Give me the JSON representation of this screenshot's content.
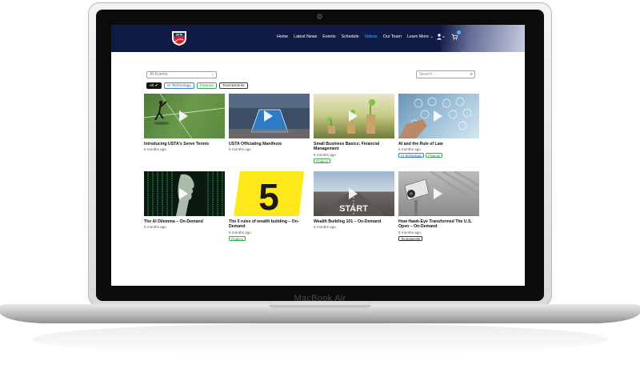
{
  "device": {
    "brand": "MacBook Air"
  },
  "nav": {
    "logo_text": "USTA",
    "items": [
      "Home",
      "Latest News",
      "Events",
      "Schedule",
      "Videos",
      "Our Team",
      "Learn More ⌄"
    ],
    "active_item": "Videos"
  },
  "filters": {
    "events_select": "All Events",
    "search_placeholder": "Search ...",
    "chips": [
      "All ✔",
      "AI Technology",
      "Finance",
      "Tournaments"
    ]
  },
  "videos": [
    {
      "title": "Introducing USTA's Serve Tennis",
      "date": "5 months ago",
      "tags": []
    },
    {
      "title": "USTA Officiating Manifesto",
      "date": "5 months ago",
      "tags": []
    },
    {
      "title": "Small Business Basics: Financial Management",
      "date": "6 months ago",
      "tags": [
        "Finance"
      ]
    },
    {
      "title": "AI and the Rule of Law",
      "date": "6 months ago",
      "tags": [
        "AI Technology",
        "Finance"
      ]
    },
    {
      "title": "The AI Dilemma – On-Demand",
      "date": "6 months ago",
      "tags": []
    },
    {
      "title": "The 5 rules of wealth building – On-Demand",
      "date": "6 months ago",
      "tags": [
        "Finance"
      ]
    },
    {
      "title": "Wealth Building 101 – On-Demand",
      "date": "6 months ago",
      "tags": []
    },
    {
      "title": "How Hawk-Eye Transformed The U.S. Open – On-Demand",
      "date": "6 months ago",
      "tags": [
        "Tournaments"
      ]
    }
  ],
  "thumb_text": {
    "five": "5",
    "start": "START"
  },
  "colors": {
    "nav_bg": "#0f1a45",
    "active_link": "#4fb3ff",
    "finance": "#3aa84a",
    "ai": "#3b7ed4"
  }
}
